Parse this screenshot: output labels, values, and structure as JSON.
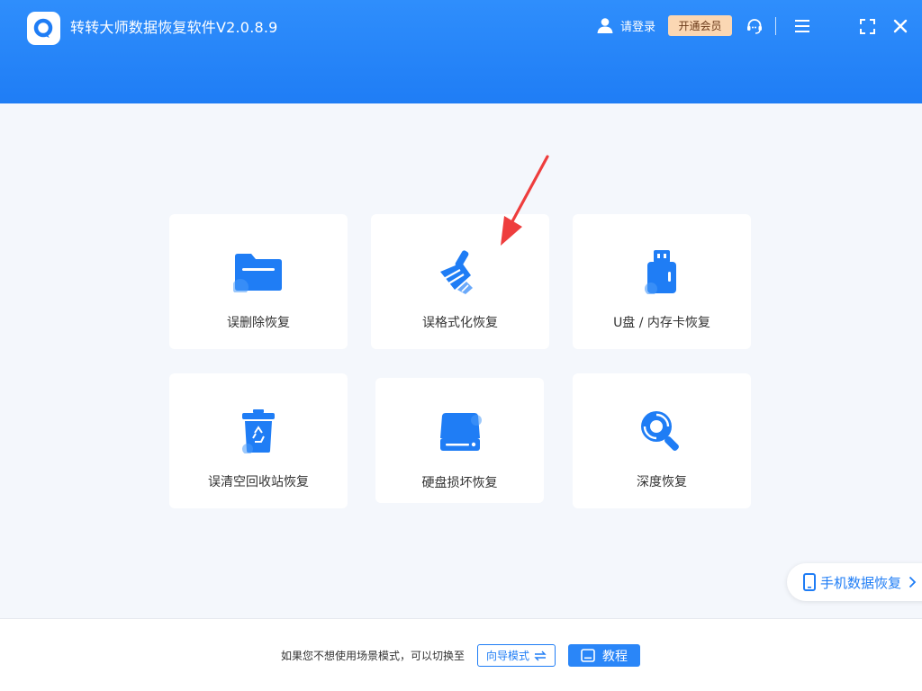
{
  "app": {
    "title": "转转大师数据恢复软件V2.0.8.9",
    "login_label": "请登录",
    "vip_label": "开通会员"
  },
  "header_icons": [
    "user-icon",
    "headset-icon",
    "menu-icon",
    "fullscreen-icon",
    "close-icon"
  ],
  "cards": [
    {
      "label": "误删除恢复",
      "icon": "folder-icon"
    },
    {
      "label": "误格式化恢复",
      "icon": "broom-icon"
    },
    {
      "label": "U盘 / 内存卡恢复",
      "icon": "usb-drive-icon"
    },
    {
      "label": "误清空回收站恢复",
      "icon": "recycle-bin-icon"
    },
    {
      "label": "硬盘损坏恢复",
      "icon": "hard-disk-icon"
    },
    {
      "label": "深度恢复",
      "icon": "deep-scan-icon"
    }
  ],
  "phone_recovery": {
    "label": "手机数据恢复"
  },
  "footer": {
    "hint": "如果您不想使用场景模式，可以切换至",
    "guide_button": "向导模式",
    "tutorial_button": "教程"
  },
  "colors": {
    "brand": "#1f7df5",
    "header": "#2a86f8",
    "vip": "#fbd7b3",
    "arrow": "#ee3d3d",
    "background": "#f4f7fc"
  }
}
